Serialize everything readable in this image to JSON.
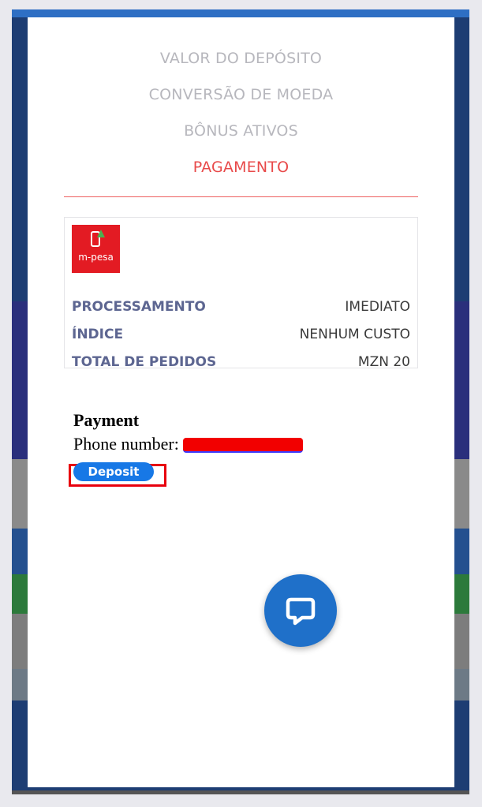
{
  "steps": [
    {
      "label": "VALOR DO DEPÓSITO"
    },
    {
      "label": "CONVERSÃO DE MOEDA"
    },
    {
      "label": "BÔNUS ATIVOS"
    },
    {
      "label": "PAGAMENTO"
    }
  ],
  "method": {
    "logo_text": "m-pesa",
    "rows": [
      {
        "key": "PROCESSAMENTO",
        "value": "IMEDIATO"
      },
      {
        "key": "ÍNDICE",
        "value": "NENHUM CUSTO"
      },
      {
        "key": "TOTAL DE PEDIDOS",
        "value": "MZN 20"
      }
    ]
  },
  "payment": {
    "title": "Payment",
    "phone_label": "Phone number:",
    "deposit_label": "Deposit"
  },
  "colors": {
    "accent_red": "#e84a4a",
    "button_blue": "#1778e6",
    "fab_blue": "#1f70c9",
    "mpesa_red": "#e31b23"
  },
  "icons": {
    "chat": "chat-bubble-icon"
  }
}
